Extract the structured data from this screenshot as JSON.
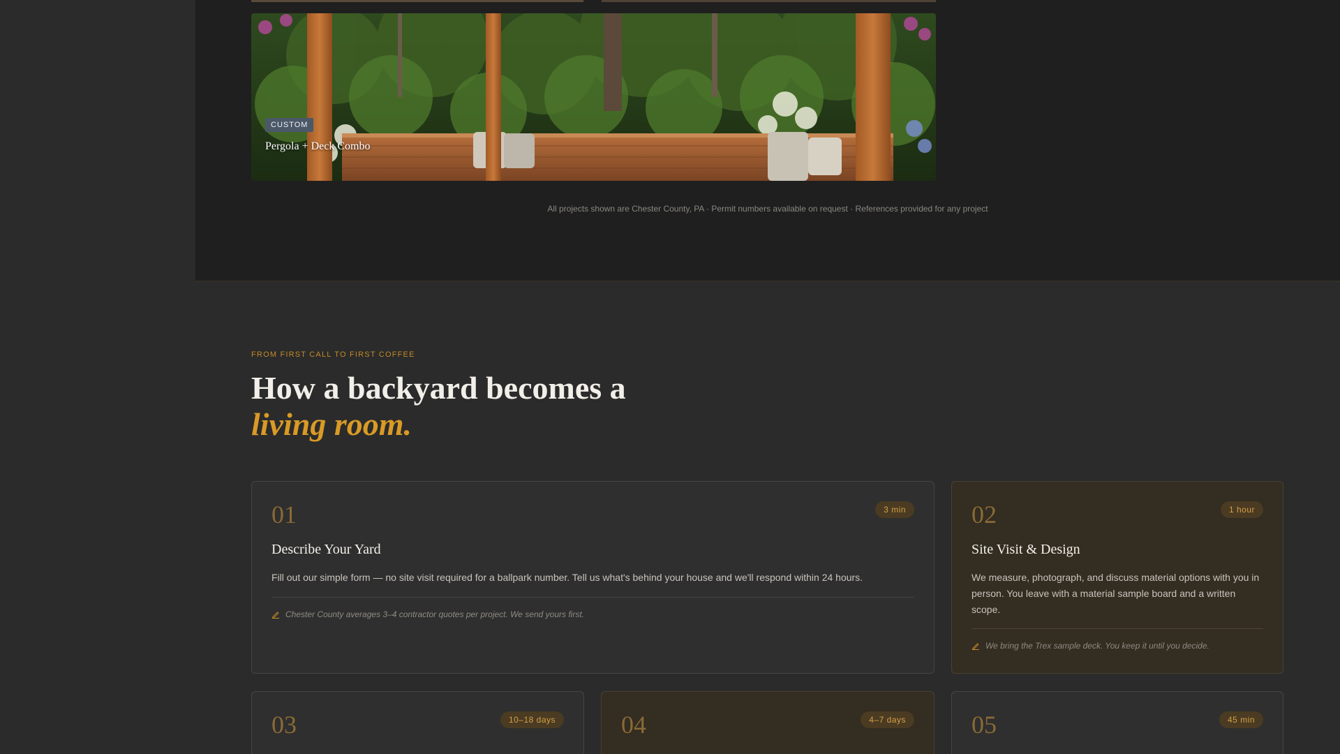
{
  "gallery": {
    "card": {
      "tag": "CUSTOM",
      "title": "Pergola + Deck Combo"
    },
    "disclaimer": "All projects shown are Chester County, PA · Permit numbers available on request · References provided for any project"
  },
  "process": {
    "eyebrow": "FROM FIRST CALL TO FIRST COFFEE",
    "headline_line1": "How a backyard becomes a",
    "headline_accent": "living room.",
    "steps": [
      {
        "num": "01",
        "time": "3 min",
        "title": "Describe Your Yard",
        "desc": "Fill out our simple form — no site visit required for a ballpark number. Tell us what's behind your house and we'll respond within 24 hours.",
        "note": "Chester County averages 3–4 contractor quotes per project. We send yours first."
      },
      {
        "num": "02",
        "time": "1 hour",
        "title": "Site Visit & Design",
        "desc": "We measure, photograph, and discuss material options with you in person. You leave with a material sample board and a written scope.",
        "note": "We bring the Trex sample deck. You keep it until you decide."
      },
      {
        "num": "03",
        "time": "10–18 days"
      },
      {
        "num": "04",
        "time": "4–7 days"
      },
      {
        "num": "05",
        "time": "45 min"
      }
    ]
  },
  "colors": {
    "accent": "#d99a26",
    "panel": "#1f1f1f",
    "page": "#2b2b2b"
  },
  "icons": {
    "note": "pencil-icon"
  }
}
